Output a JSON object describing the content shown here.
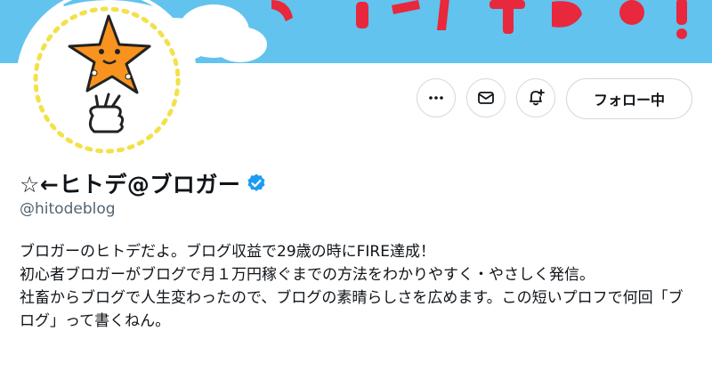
{
  "profile": {
    "display_name": "☆←ヒトデ@ブロガー",
    "handle": "@hitodeblog",
    "verified": true,
    "bio_lines": [
      "ブロガーのヒトデだよ。ブログ収益で29歳の時にFIRE達成！",
      "初心者ブロガーがブログで月１万円稼ぐまでの方法をわかりやすく・やさしく発信。",
      "社畜からブログで人生変わったので、ブログの素晴らしさを広めます。この短いプロフで何回「ブログ」って書くねん。"
    ]
  },
  "actions": {
    "more_icon": "more-horizontal-icon",
    "message_icon": "envelope-icon",
    "notify_icon": "bell-plus-icon",
    "follow_label": "フォロー中"
  },
  "colors": {
    "banner": "#62c3ee",
    "banner_text": "#e8283c",
    "mascot": "#f7931e",
    "verified": "#1d9bf0",
    "handle": "#536471"
  }
}
